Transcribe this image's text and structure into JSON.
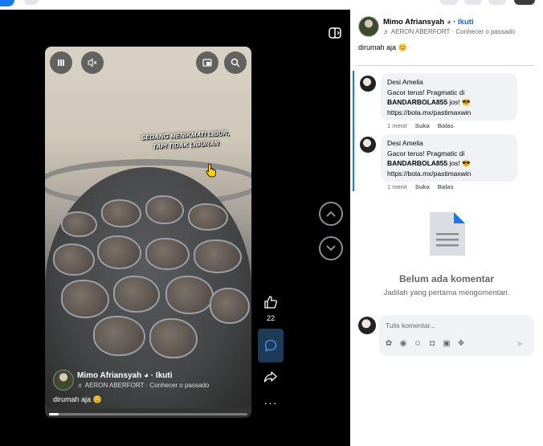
{
  "post": {
    "author": "Mimo Afriansyah",
    "follow_label": "Ikuti",
    "music": "AERON ABERFORT · Conhecer o passado",
    "caption": "dirumah aja 😊"
  },
  "video": {
    "overlay_text_line1": "SEDANG MENIKMATI LIBUR,",
    "overlay_text_line2": "TAPI TIDAK LIBURAN",
    "author": "Mimo Afriansyah",
    "follow_label": "Ikuti",
    "music": "AERON ABERFORT · Conhecer o passado",
    "caption": "dirumah aja 😊",
    "progress_percent": 5
  },
  "actions": {
    "like_count": "22"
  },
  "comments": [
    {
      "author": "Desi Amelia",
      "text_before": "Gacor terus! Pragmatic di",
      "bold": "BANDARBOLA855",
      "text_after": " jos! 😎",
      "link": "https://bola.mx/pastimaxwin",
      "time": "1 menit",
      "like_label": "Suka",
      "reply_label": "Balas"
    },
    {
      "author": "Desi Amelia",
      "text_before": "Gacor terus! Pragmatic di",
      "bold": "BANDARBOLA855",
      "text_after": " jos! 😎",
      "link": "https://bola.mx/pastimaxwin",
      "time": "1 menit",
      "like_label": "Suka",
      "reply_label": "Balas"
    }
  ],
  "empty_state": {
    "title": "Belum ada komentar",
    "subtitle": "Jadilah yang pertama mengomentari."
  },
  "composer": {
    "placeholder": "Tulis komentar..."
  },
  "colors": {
    "accent": "#0866ff",
    "thread_line": "#1877f2",
    "comment_button": "#1d3a57"
  }
}
